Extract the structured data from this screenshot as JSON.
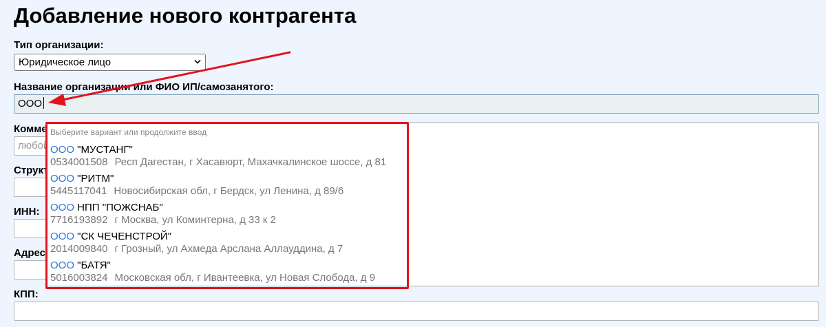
{
  "page": {
    "title": "Добавление нового контрагента"
  },
  "form": {
    "org_type": {
      "label": "Тип организации:",
      "value": "Юридическое лицо"
    },
    "org_name": {
      "label": "Название организации или ФИО ИП/самозанятого:",
      "value": "ООО"
    },
    "comment": {
      "label": "Комментарий:",
      "placeholder": "любой"
    },
    "structure": {
      "label": "Структура:"
    },
    "inn": {
      "label": "ИНН:"
    },
    "address": {
      "label": "Адрес:"
    },
    "kpp": {
      "label": "КПП:"
    }
  },
  "suggestions": {
    "hint": "Выберите вариант или продолжите ввод",
    "items": [
      {
        "prefix": "ООО",
        "name": " \"МУСТАНГ\"",
        "inn": "0534001508",
        "address": "Респ Дагестан, г Хасавюрт, Махачкалинское шоссе, д 81"
      },
      {
        "prefix": "ООО",
        "name": " \"РИТМ\"",
        "inn": "5445117041",
        "address": "Новосибирская обл, г Бердск, ул Ленина, д 89/6"
      },
      {
        "prefix": "ООО",
        "name": " НПП \"ПОЖСНАБ\"",
        "inn": "7716193892",
        "address": "г Москва, ул Коминтерна, д 33 к 2"
      },
      {
        "prefix": "ООО",
        "name": " \"СК ЧЕЧЕНСТРОЙ\"",
        "inn": "2014009840",
        "address": "г Грозный, ул Ахмеда Арслана Аллауддина, д 7"
      },
      {
        "prefix": "ООО",
        "name": " \"БАТЯ\"",
        "inn": "5016003824",
        "address": "Московская обл, г Ивантеевка, ул Новая Слобода, д 9"
      }
    ]
  },
  "colors": {
    "highlight": "#2878d4",
    "annotation": "#e4121c",
    "background": "#eef5fe"
  }
}
